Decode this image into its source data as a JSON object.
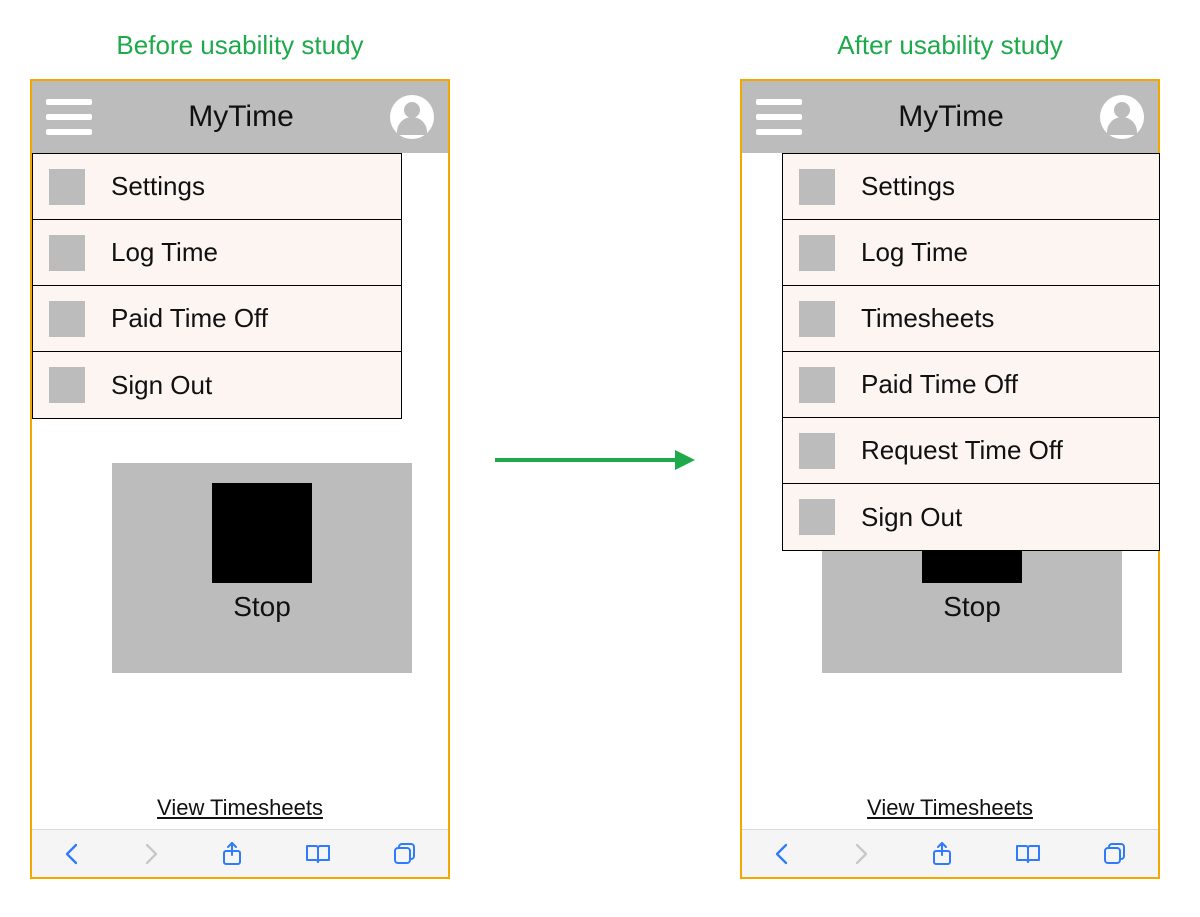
{
  "left": {
    "caption": "Before usability study",
    "app_title": "MyTime",
    "menu": [
      {
        "label": "Settings"
      },
      {
        "label": "Log Time"
      },
      {
        "label": "Paid Time Off"
      },
      {
        "label": "Sign Out"
      }
    ],
    "stop_label": "Stop",
    "view_link": "View Timesheets"
  },
  "right": {
    "caption": "After usability study",
    "app_title": "MyTime",
    "menu": [
      {
        "label": "Settings"
      },
      {
        "label": "Log Time"
      },
      {
        "label": "Timesheets"
      },
      {
        "label": "Paid Time Off"
      },
      {
        "label": "Request Time Off"
      },
      {
        "label": "Sign Out"
      }
    ],
    "stop_label": "Stop",
    "view_link": "View Timesheets"
  }
}
